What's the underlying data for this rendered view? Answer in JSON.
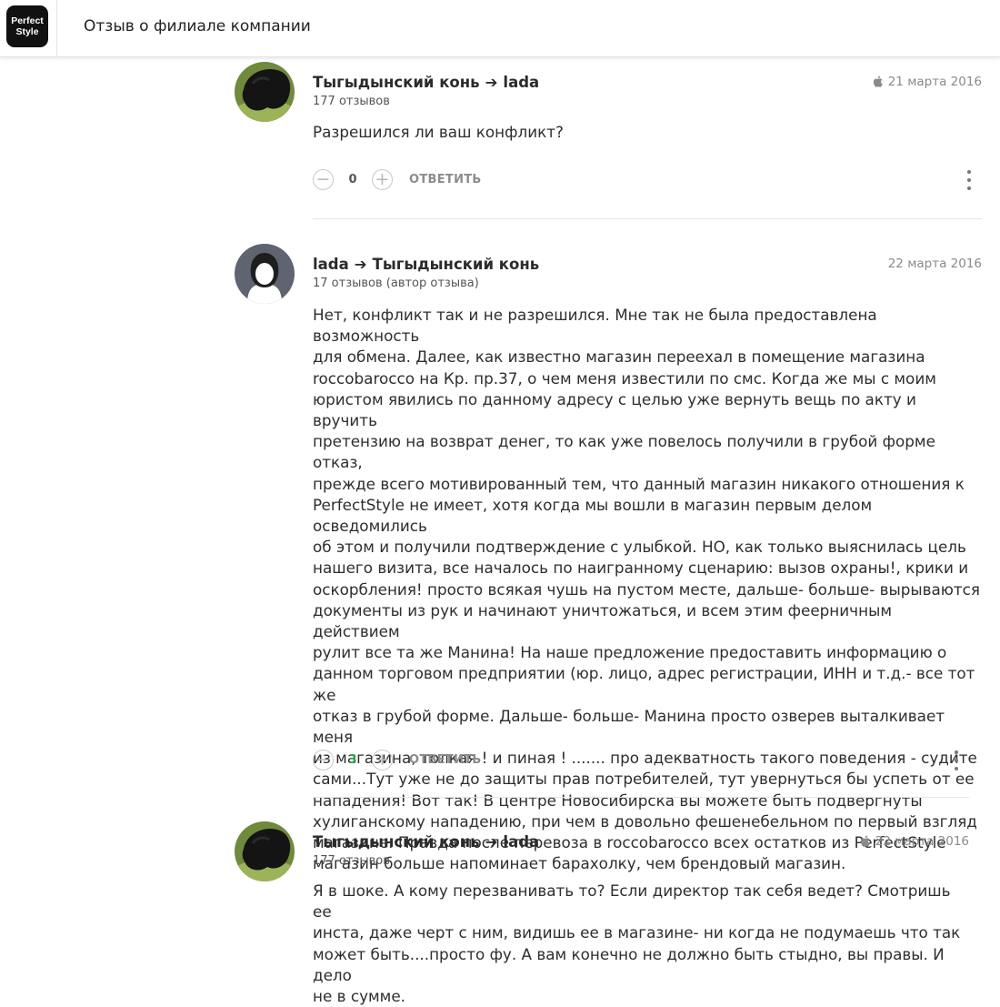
{
  "header": {
    "logo_line1": "Perfect",
    "logo_line2": "Style",
    "title": "Отзыв о филиале компании"
  },
  "comments": [
    {
      "author": "Тыгыдынский конь",
      "arrow": "➔",
      "recipient": "lada",
      "meta": "177 отзывов",
      "date": "21 марта 2016",
      "device_icon": "apple-icon",
      "text": "Разрешился ли ваш конфликт?",
      "score": "0",
      "reply_label": "ОТВЕТИТЬ"
    },
    {
      "author": "lada",
      "arrow": "➔",
      "recipient": "Тыгыдынский конь",
      "meta": "17 отзывов (автор отзыва)",
      "date": "22 марта 2016",
      "text_lines": [
        "Нет, конфликт так и не разрешился. Мне так не была предоставлена возможность",
        "для обмена. Далее, как известно магазин переехал в помещение магазина",
        "roccobarocco на Кр. пр.37, о чем меня известили по смс. Когда же мы с моим",
        "юристом явились по данному адресу с целью уже вернуть вещь по акту и вручить",
        "претензию на возврат денег, то как уже повелось получили в грубой форме отказ,",
        "прежде всего мотивированный тем, что данный магазин никакого отношения к",
        "PerfectStyle не имеет, хотя когда мы вошли в магазин первым делом осведомились",
        "об этом и получили подтверждение с улыбкой. НО, как только выяснилась цель",
        "нашего визита, все началось по наигранному сценарию: вызов охраны!, крики и",
        "оскорбления! просто всякая чушь на пустом месте, дальше- больше- вырываются",
        "документы из рук и начинают уничтожаться, и всем этим феерничным действием",
        "рулит все та же Манина! На наше предложение предоставить информацию о",
        "данном торговом предприятии (юр. лицо, адрес регистрации, ИНН и т.д.- все тот же",
        "отказ в грубой форме. Дальше- больше- Манина просто озверев выталкивает меня",
        "из магазина, толкая ! и пиная ! ....... про адекватность такого поведения - судите",
        "сами...Тут уже не до защиты прав потребителей, тут увернуться бы успеть от ее",
        "нападения! Вот так! В центре Новосибирска вы можете быть подвергнуты",
        "хулиганскому нападению, при чем в довольно фешенебельном по первый взгляд",
        "магазине. Правда после перевоза в roccobarocco всех остатков из PerfectStyle",
        "магазин больше напоминает барахолку, чем брендовый магазин."
      ],
      "score": "3",
      "reply_label": "ОТВЕТИТЬ"
    },
    {
      "author": "Тыгыдынский конь",
      "arrow": "➔",
      "recipient": "lada",
      "meta": "177 отзывов",
      "date": "22 марта 2016",
      "device_icon": "apple-icon",
      "text_lines": [
        "Я в шоке. А кому перезванивать то? Если директор так себя ведет? Смотришь ее",
        "инста, даже черт с ним, видишь ее в магазине- ни когда не подумаешь что так",
        "может быть....просто фу. А вам конечно не должно быть стыдно, вы правы. И дело",
        "не в сумме."
      ]
    }
  ],
  "colors": {
    "score_positive": "#2e9e4f",
    "muted": "#8a8a8a"
  }
}
